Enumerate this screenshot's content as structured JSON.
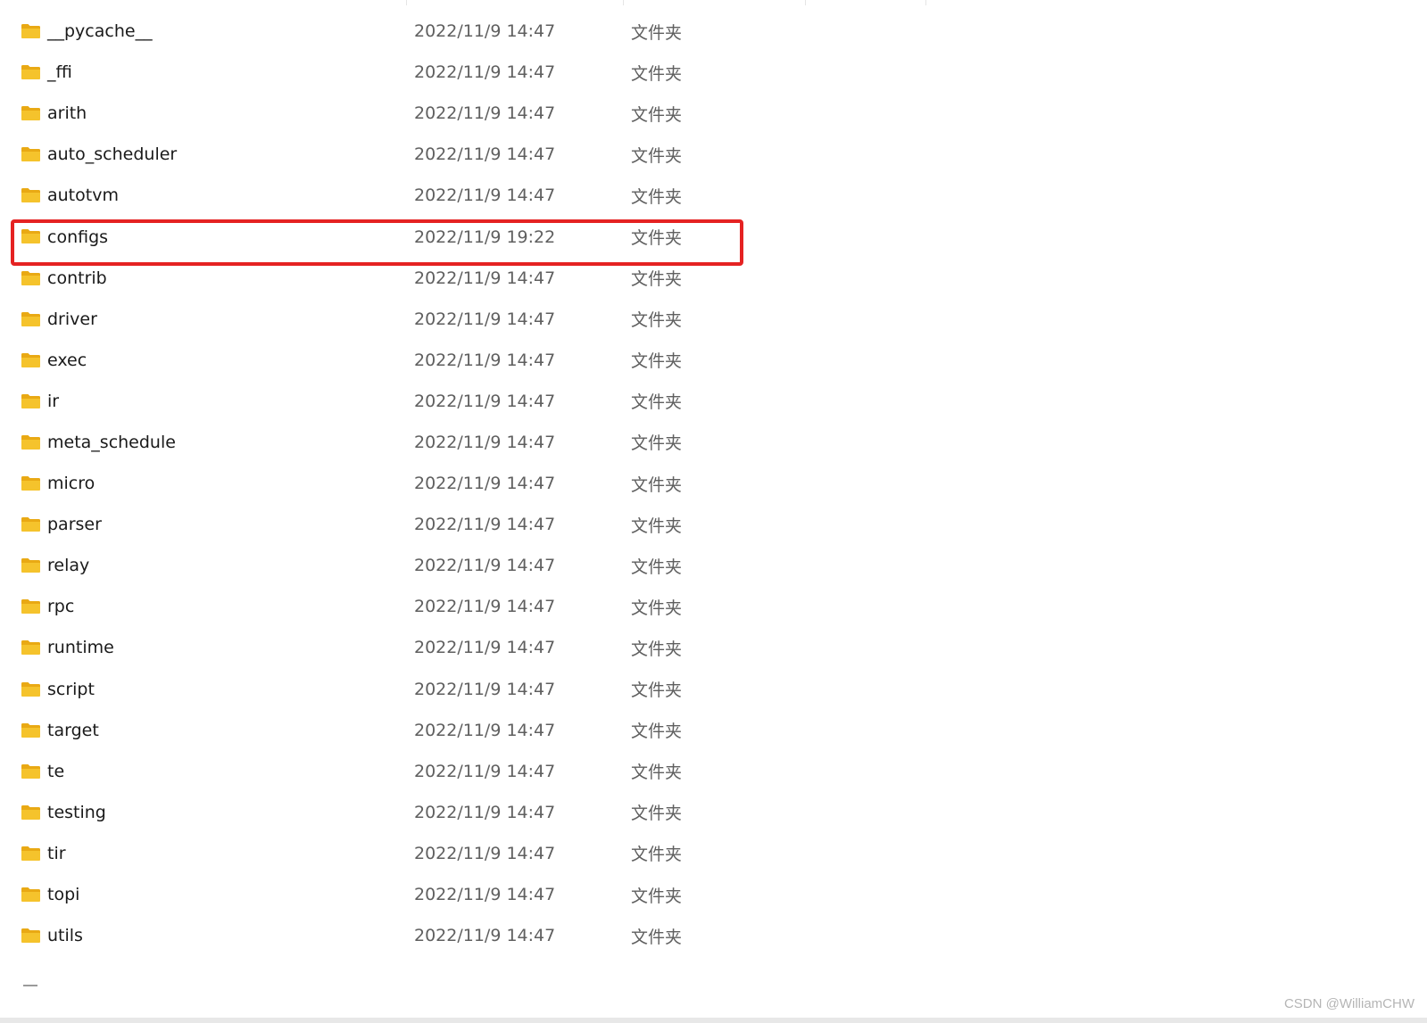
{
  "icons": {
    "folder": "folder-icon",
    "folder_color": "#f5c32c",
    "folder_tab_color": "#e9a914"
  },
  "highlight": {
    "color": "#e52222",
    "target": "configs"
  },
  "files": [
    {
      "name": "__pycache__",
      "modified": "2022/11/9 14:47",
      "type": "文件夹"
    },
    {
      "name": "_ffi",
      "modified": "2022/11/9 14:47",
      "type": "文件夹"
    },
    {
      "name": "arith",
      "modified": "2022/11/9 14:47",
      "type": "文件夹"
    },
    {
      "name": "auto_scheduler",
      "modified": "2022/11/9 14:47",
      "type": "文件夹"
    },
    {
      "name": "autotvm",
      "modified": "2022/11/9 14:47",
      "type": "文件夹"
    },
    {
      "name": "configs",
      "modified": "2022/11/9 19:22",
      "type": "文件夹"
    },
    {
      "name": "contrib",
      "modified": "2022/11/9 14:47",
      "type": "文件夹"
    },
    {
      "name": "driver",
      "modified": "2022/11/9 14:47",
      "type": "文件夹"
    },
    {
      "name": "exec",
      "modified": "2022/11/9 14:47",
      "type": "文件夹"
    },
    {
      "name": "ir",
      "modified": "2022/11/9 14:47",
      "type": "文件夹"
    },
    {
      "name": "meta_schedule",
      "modified": "2022/11/9 14:47",
      "type": "文件夹"
    },
    {
      "name": "micro",
      "modified": "2022/11/9 14:47",
      "type": "文件夹"
    },
    {
      "name": "parser",
      "modified": "2022/11/9 14:47",
      "type": "文件夹"
    },
    {
      "name": "relay",
      "modified": "2022/11/9 14:47",
      "type": "文件夹"
    },
    {
      "name": "rpc",
      "modified": "2022/11/9 14:47",
      "type": "文件夹"
    },
    {
      "name": "runtime",
      "modified": "2022/11/9 14:47",
      "type": "文件夹"
    },
    {
      "name": "script",
      "modified": "2022/11/9 14:47",
      "type": "文件夹"
    },
    {
      "name": "target",
      "modified": "2022/11/9 14:47",
      "type": "文件夹"
    },
    {
      "name": "te",
      "modified": "2022/11/9 14:47",
      "type": "文件夹"
    },
    {
      "name": "testing",
      "modified": "2022/11/9 14:47",
      "type": "文件夹"
    },
    {
      "name": "tir",
      "modified": "2022/11/9 14:47",
      "type": "文件夹"
    },
    {
      "name": "topi",
      "modified": "2022/11/9 14:47",
      "type": "文件夹"
    },
    {
      "name": "utils",
      "modified": "2022/11/9 14:47",
      "type": "文件夹"
    }
  ],
  "watermark": "CSDN @WilliamCHW"
}
